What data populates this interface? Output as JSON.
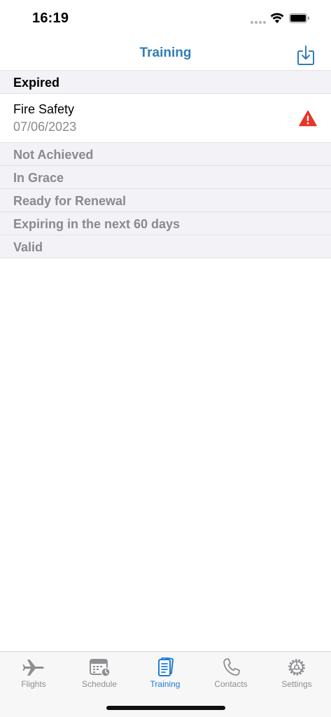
{
  "status": {
    "time": "16:19"
  },
  "nav": {
    "title": "Training",
    "download_icon": "download-tray-icon"
  },
  "sections": [
    {
      "label": "Expired",
      "state": "active",
      "items": [
        {
          "title": "Fire Safety",
          "date": "07/06/2023",
          "icon": "warning-triangle-icon"
        }
      ]
    },
    {
      "label": "Not Achieved",
      "state": "muted",
      "items": []
    },
    {
      "label": "In Grace",
      "state": "muted",
      "items": []
    },
    {
      "label": "Ready for Renewal",
      "state": "muted",
      "items": []
    },
    {
      "label": "Expiring in the next 60 days",
      "state": "muted",
      "items": []
    },
    {
      "label": "Valid",
      "state": "muted",
      "items": []
    }
  ],
  "tabs": [
    {
      "label": "Flights",
      "icon": "airplane-icon",
      "selected": false
    },
    {
      "label": "Schedule",
      "icon": "calendar-clock-icon",
      "selected": false
    },
    {
      "label": "Training",
      "icon": "document-icon",
      "selected": true
    },
    {
      "label": "Contacts",
      "icon": "phone-icon",
      "selected": false
    },
    {
      "label": "Settings",
      "icon": "gear-icon",
      "selected": false
    }
  ],
  "colors": {
    "accent": "#2f7db8",
    "tab_selected": "#1d7ad6",
    "tab_unselected": "#8e8e93",
    "warning": "#e8352a",
    "section_bg": "#f2f2f7",
    "muted_text": "#8a8a8e"
  }
}
